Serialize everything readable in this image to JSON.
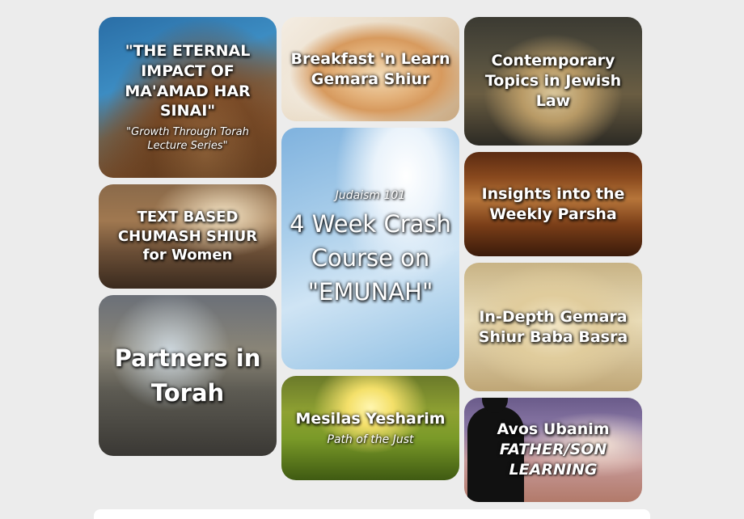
{
  "tiles": {
    "eternal": {
      "title": "\"THE ETERNAL IMPACT OF MA'AMAD HAR SINAI\"",
      "subtitle": "\"Growth Through Torah Lecture Series\""
    },
    "breakfast": {
      "title": "Breakfast 'n Learn Gemara Shiur"
    },
    "contemporary": {
      "title": "Contemporary Topics in Jewish Law"
    },
    "text_based": {
      "title": "TEXT BASED CHUMASH SHIUR for Women"
    },
    "crash_course": {
      "kicker": "Judaism 101",
      "title": "4 Week Crash Course on \"EMUNAH\""
    },
    "insights": {
      "title": "Insights into the Weekly Parsha"
    },
    "partners": {
      "title": "Partners in Torah"
    },
    "in_depth": {
      "title": "In-Depth Gemara Shiur Baba Basra"
    },
    "mesilas": {
      "title": "Mesilas Yesharim",
      "subtitle": "Path of the Just"
    },
    "avos": {
      "title": "Avos Ubanim",
      "subtitle": "FATHER/SON LEARNING"
    }
  }
}
